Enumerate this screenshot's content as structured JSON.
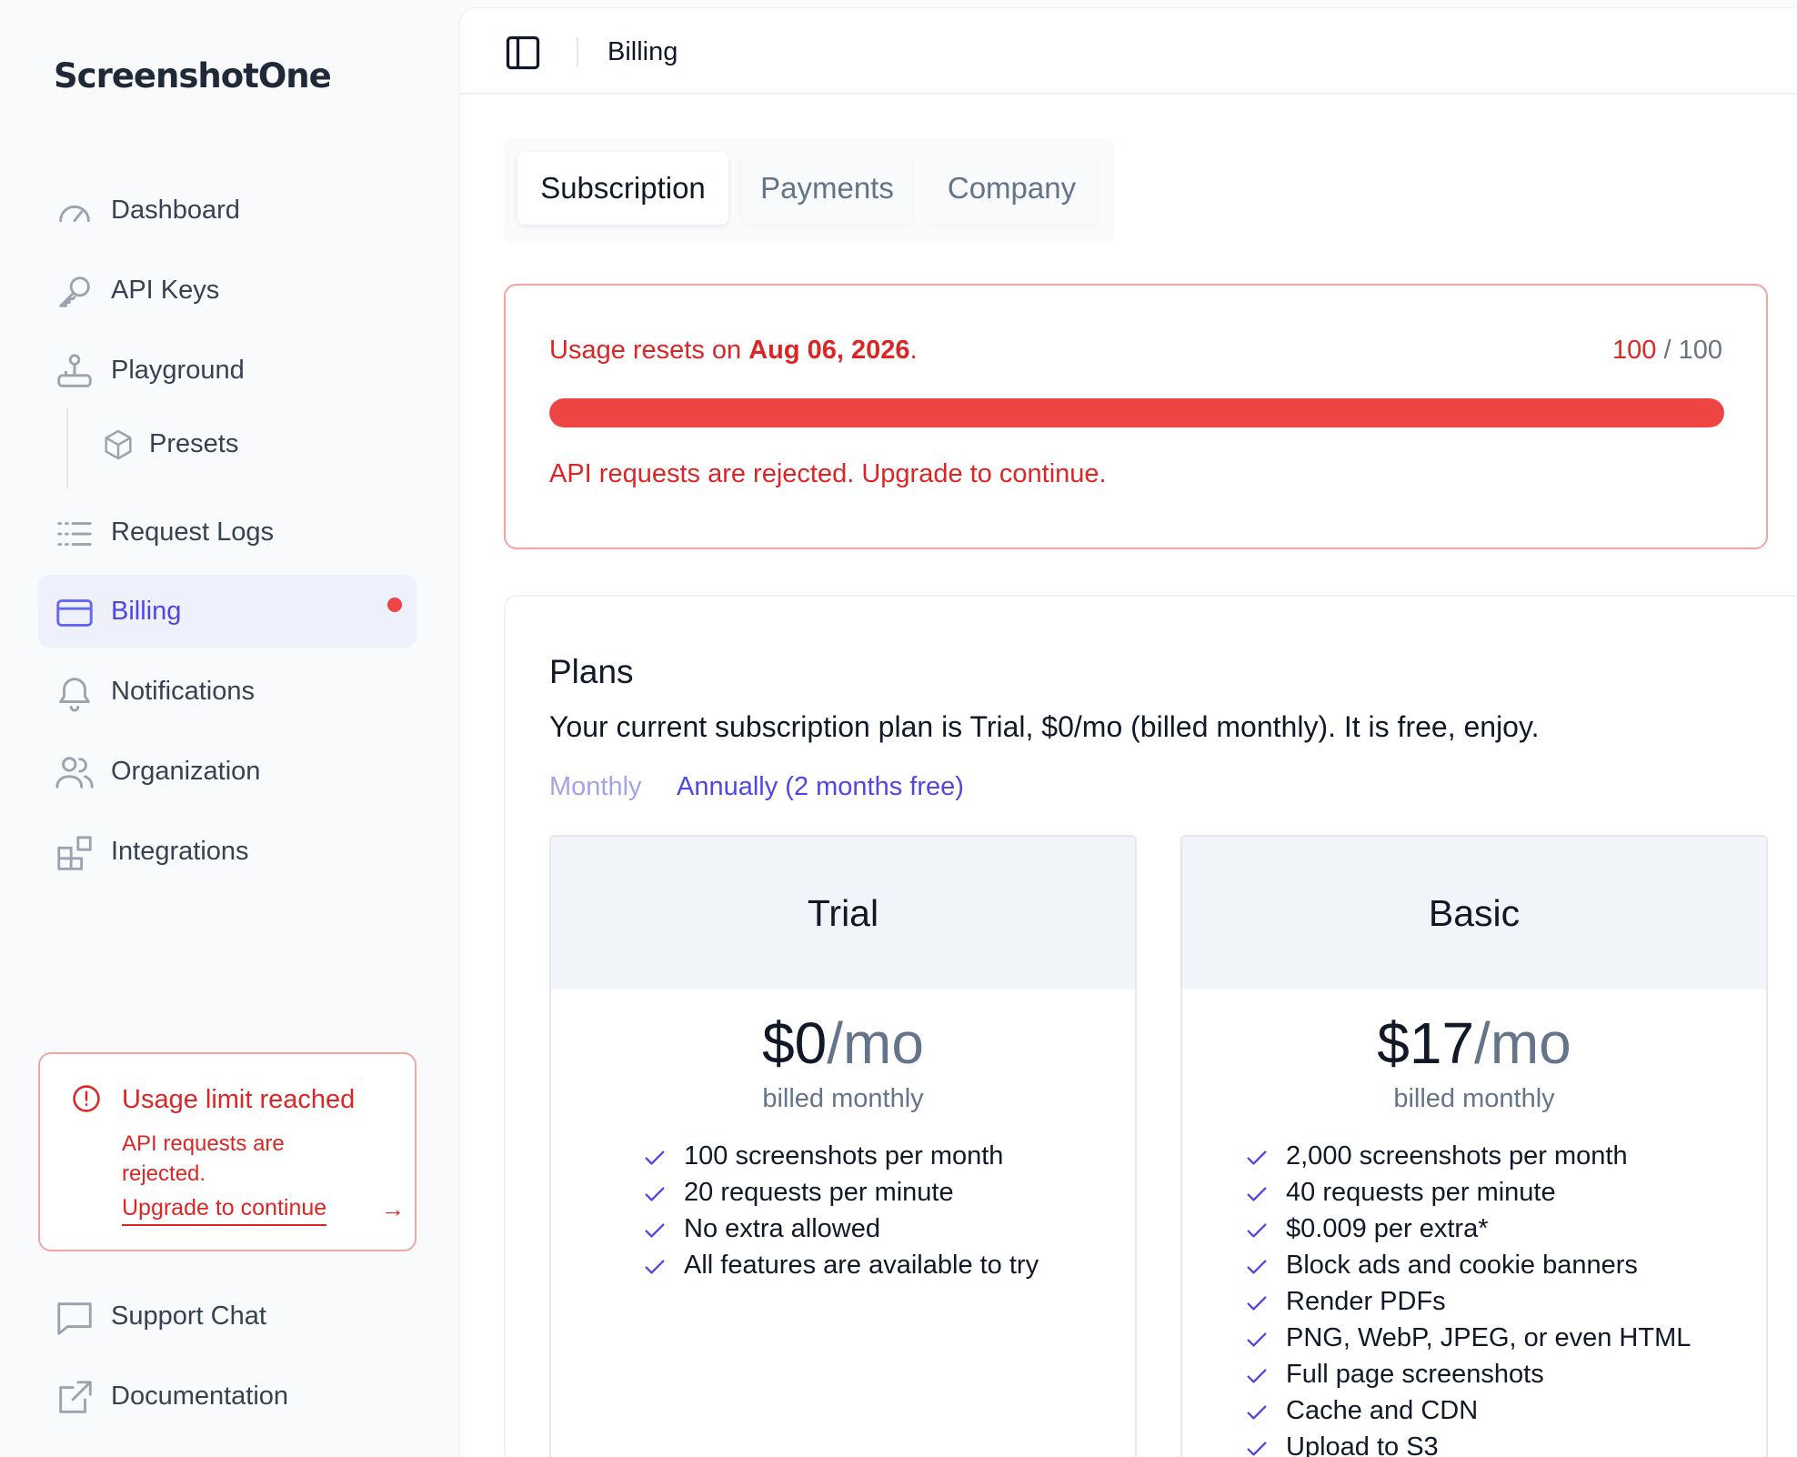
{
  "brand": {
    "name": "ScreenshotOne"
  },
  "sidebar": {
    "items": [
      {
        "label": "Dashboard",
        "icon": "gauge-icon"
      },
      {
        "label": "API Keys",
        "icon": "key-icon"
      },
      {
        "label": "Playground",
        "icon": "joystick-icon"
      },
      {
        "label": "Presets",
        "icon": "cube-icon"
      },
      {
        "label": "Request Logs",
        "icon": "list-icon"
      },
      {
        "label": "Billing",
        "icon": "credit-card-icon",
        "active": true,
        "has_alert": true
      },
      {
        "label": "Notifications",
        "icon": "bell-icon"
      },
      {
        "label": "Organization",
        "icon": "users-icon"
      },
      {
        "label": "Integrations",
        "icon": "blocks-icon"
      }
    ],
    "limit_alert": {
      "title": "Usage limit reached",
      "description": "API requests are rejected.",
      "link": "Upgrade to continue"
    },
    "footer": [
      {
        "label": "Support Chat",
        "icon": "chat-icon"
      },
      {
        "label": "Documentation",
        "icon": "external-link-icon"
      }
    ]
  },
  "header": {
    "breadcrumb": "Billing"
  },
  "tabs": [
    {
      "label": "Subscription",
      "active": true
    },
    {
      "label": "Payments"
    },
    {
      "label": "Company"
    }
  ],
  "usage": {
    "reset_prefix": "Usage resets on",
    "reset_date": "Aug 06, 2026",
    "reset_suffix": ".",
    "used": "100",
    "separator": "/",
    "limit": "100",
    "progress_fraction": 1.0,
    "warning": "API requests are rejected. Upgrade to continue."
  },
  "plans": {
    "title": "Plans",
    "description": "Your current subscription plan is Trial, $0/mo (billed monthly). It is free, enjoy.",
    "period_options": [
      "Monthly",
      "Annually (2 months free)"
    ],
    "items": [
      {
        "name": "Trial",
        "price": "$0",
        "per": "/mo",
        "billed": "billed monthly",
        "features": [
          "100 screenshots per month",
          "20 requests per minute",
          "No extra allowed",
          "All features are available to try"
        ]
      },
      {
        "name": "Basic",
        "price": "$17",
        "per": "/mo",
        "billed": "billed monthly",
        "features": [
          "2,000 screenshots per month",
          "40 requests per minute",
          "$0.009 per extra*",
          "Block ads and cookie banners",
          "Render PDFs",
          "PNG, WebP, JPEG, or even HTML",
          "Full page screenshots",
          "Cache and CDN",
          "Upload to S3"
        ]
      }
    ]
  },
  "colors": {
    "accent": "#4f46e5",
    "danger": "#dc2626",
    "progress": "#ef4444"
  }
}
